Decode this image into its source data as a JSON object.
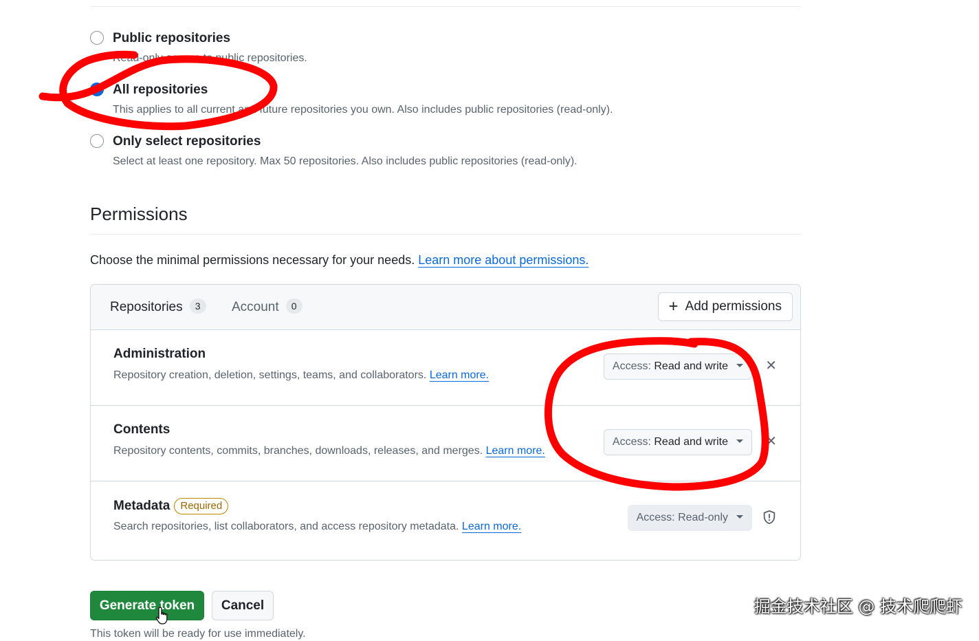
{
  "repository_access": {
    "options": [
      {
        "label": "Public repositories",
        "description": "Read-only access to public repositories.",
        "selected": false
      },
      {
        "label": "All repositories",
        "description": "This applies to all current and future repositories you own. Also includes public repositories (read-only).",
        "selected": true
      },
      {
        "label": "Only select repositories",
        "description": "Select at least one repository. Max 50 repositories. Also includes public repositories (read-only).",
        "selected": false
      }
    ]
  },
  "permissions": {
    "heading": "Permissions",
    "intro": "Choose the minimal permissions necessary for your needs.",
    "intro_link": "Learn more about permissions.",
    "tabs": [
      {
        "label": "Repositories",
        "count": "3"
      },
      {
        "label": "Account",
        "count": "0"
      }
    ],
    "add_button": "Add permissions",
    "rows": [
      {
        "title": "Administration",
        "description": "Repository creation, deletion, settings, teams, and collaborators.",
        "link": "Learn more.",
        "access_prefix": "Access:",
        "access_value": "Read and write"
      },
      {
        "title": "Contents",
        "description": "Repository contents, commits, branches, downloads, releases, and merges.",
        "link": "Learn more.",
        "access_prefix": "Access:",
        "access_value": "Read and write"
      },
      {
        "title": "Metadata",
        "badge": "Required",
        "description": "Search repositories, list collaborators, and access repository metadata.",
        "link": "Learn more.",
        "access_prefix": "Access:",
        "access_value": "Read-only"
      }
    ]
  },
  "actions": {
    "generate": "Generate token",
    "cancel": "Cancel",
    "footer_note": "This token will be ready for use immediately."
  },
  "watermark": "掘金技术社区 @ 技术爬爬虾",
  "colors": {
    "accent": "#0969da",
    "primary_button": "#1f883d",
    "annotation": "#ff0000",
    "badge": "#9a6700"
  },
  "icons": [
    "plus-icon",
    "caret-down-icon",
    "close-icon",
    "shield-icon",
    "hand-cursor-icon"
  ]
}
